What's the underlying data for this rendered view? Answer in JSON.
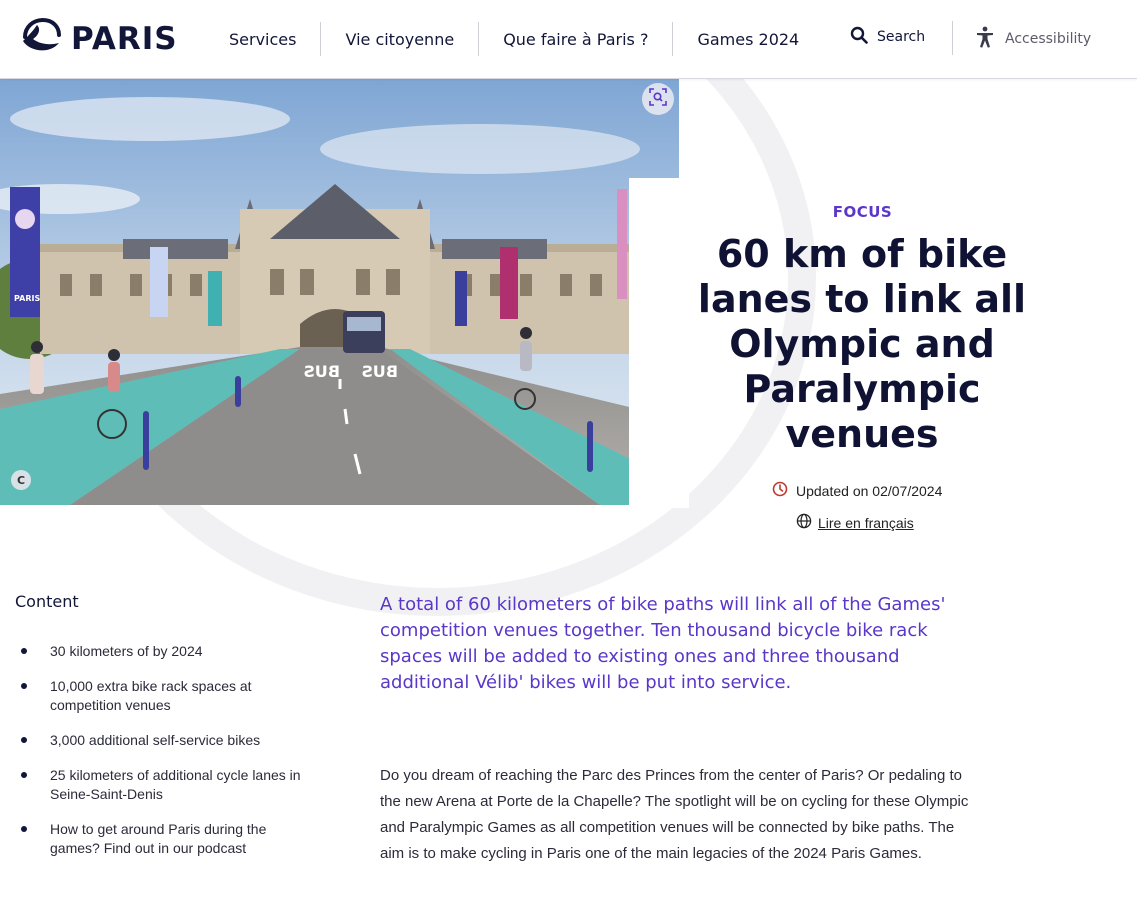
{
  "header": {
    "logo_text": "PARIS",
    "nav": [
      "Services",
      "Vie citoyenne",
      "Que faire à Paris ?",
      "Games 2024"
    ],
    "search_label": "Search",
    "accessibility_label": "Accessibility"
  },
  "hero": {
    "copyright_badge": "C",
    "banner_text": "PARIS",
    "road_marking": "BUS",
    "category": "FOCUS",
    "title": "60 km of bike lanes to link all Olympic and Paralympic venues",
    "updated": "Updated on 02/07/2024",
    "lang_link": "Lire en français"
  },
  "sidebar": {
    "title": "Content",
    "items": [
      "30 kilometers of by 2024",
      "10,000 extra bike rack spaces at competition venues",
      "3,000 additional self-service bikes",
      "25 kilometers of additional cycle lanes in Seine-Saint-Denis",
      "How to get around Paris during the games? Find out in our podcast"
    ]
  },
  "main": {
    "lead": "A total of 60 kilometers of bike paths will link all of the Games' competition venues together. Ten thousand bicycle bike rack spaces will be added to existing ones and three thousand additional Vélib' bikes will be put into service.",
    "paragraph": "Do you dream of reaching the Parc des Princes from the center of Paris? Or pedaling to the new Arena at Porte de la Chapelle? The spotlight will be on cycling for these Olympic and Paralympic Games as all competition venues will be connected by bike paths. The aim is to make cycling in Paris one of the main legacies of the 2024 Paris Games."
  },
  "colors": {
    "accent": "#5a37c8",
    "navy": "#121638",
    "updated_icon": "#c0392b"
  },
  "icons": [
    "paris-boat-logo-icon",
    "search-icon",
    "accessibility-icon",
    "zoom-icon",
    "clock-icon",
    "globe-icon"
  ]
}
